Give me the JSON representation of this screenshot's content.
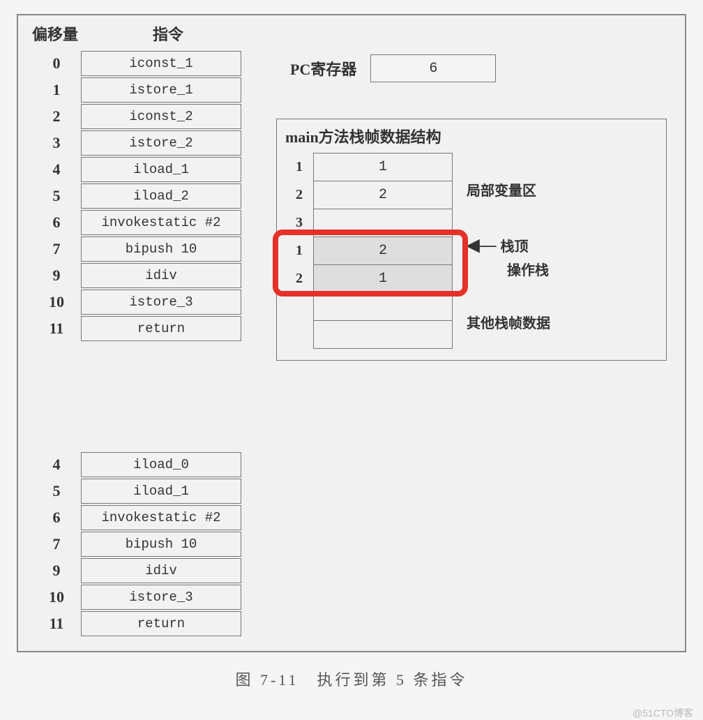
{
  "headers": {
    "offset": "偏移量",
    "instruction": "指令"
  },
  "pc": {
    "label": "PC寄存器",
    "value": "6"
  },
  "instructions_top": [
    {
      "offset": "0",
      "text": "iconst_1"
    },
    {
      "offset": "1",
      "text": "istore_1"
    },
    {
      "offset": "2",
      "text": "iconst_2"
    },
    {
      "offset": "3",
      "text": "istore_2"
    },
    {
      "offset": "4",
      "text": "iload_1"
    },
    {
      "offset": "5",
      "text": "iload_2"
    },
    {
      "offset": "6",
      "text": "invokestatic  #2"
    },
    {
      "offset": "7",
      "text": "bipush   10"
    },
    {
      "offset": "9",
      "text": "idiv"
    },
    {
      "offset": "10",
      "text": "istore_3"
    },
    {
      "offset": "11",
      "text": "return"
    }
  ],
  "instructions_bottom": [
    {
      "offset": "4",
      "text": "iload_0"
    },
    {
      "offset": "5",
      "text": "iload_1"
    },
    {
      "offset": "6",
      "text": "invokestatic  #2"
    },
    {
      "offset": "7",
      "text": "bipush   10"
    },
    {
      "offset": "9",
      "text": "idiv"
    },
    {
      "offset": "10",
      "text": "istore_3"
    },
    {
      "offset": "11",
      "text": "return"
    }
  ],
  "frame": {
    "title": "main方法栈帧数据结构",
    "locals": [
      {
        "idx": "1",
        "val": "1"
      },
      {
        "idx": "2",
        "val": "2"
      },
      {
        "idx": "3",
        "val": ""
      }
    ],
    "operand": [
      {
        "idx": "1",
        "val": "2"
      },
      {
        "idx": "2",
        "val": "1"
      }
    ],
    "other_rows": [
      "",
      ""
    ],
    "labels": {
      "locals": "局部变量区",
      "stacktop": "栈顶",
      "opstack": "操作栈",
      "other": "其他栈帧数据"
    }
  },
  "caption": "图 7-11　执行到第 5 条指令",
  "watermark": "@51CTO博客"
}
